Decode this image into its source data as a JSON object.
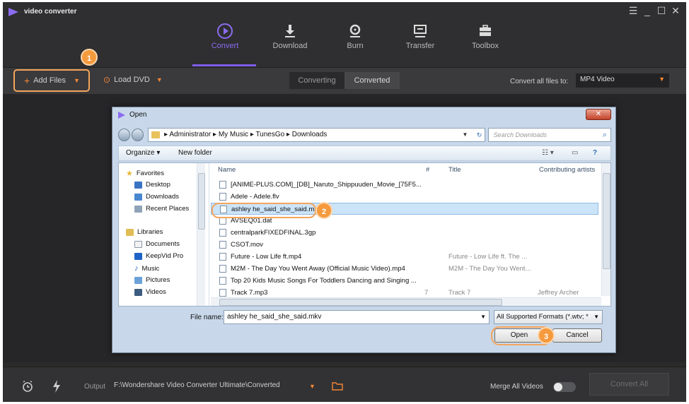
{
  "app": {
    "title": "video converter",
    "window_controls": [
      "☰",
      "_",
      "☐",
      "✕"
    ]
  },
  "nav": {
    "items": [
      {
        "label": "Convert",
        "icon": "convert-icon",
        "active": true
      },
      {
        "label": "Download",
        "icon": "download-icon"
      },
      {
        "label": "Burn",
        "icon": "burn-icon"
      },
      {
        "label": "Transfer",
        "icon": "transfer-icon"
      },
      {
        "label": "Toolbox",
        "icon": "toolbox-icon"
      }
    ]
  },
  "toolbar": {
    "add_files": "Add Files",
    "load_dvd": "Load DVD",
    "tab_converting": "Converting",
    "tab_converted": "Converted",
    "convert_all_label": "Convert all files to:",
    "format": "MP4 Video"
  },
  "badges": {
    "one": "1",
    "two": "2",
    "three": "3"
  },
  "bottom": {
    "output_label": "Output",
    "output_path": "F:\\Wondershare Video Converter Ultimate\\Converted",
    "merge_label": "Merge All Videos",
    "convert_all": "Convert All"
  },
  "dialog": {
    "title": "Open",
    "breadcrumb": [
      "Administrator",
      "My Music",
      "TunesGo",
      "Downloads"
    ],
    "breadcrumb_text": "▸ Administrator ▸ My Music ▸ TunesGo ▸ Downloads",
    "search_placeholder": "Search Downloads",
    "organize": "Organize ▾",
    "new_folder": "New folder",
    "nav_pane": {
      "favorites": "Favorites",
      "desktop": "Desktop",
      "downloads": "Downloads",
      "recent": "Recent Places",
      "libraries": "Libraries",
      "documents": "Documents",
      "keepvid": "KeepVid Pro",
      "music": "Music",
      "pictures": "Pictures",
      "videos": "Videos"
    },
    "columns": {
      "name": "Name",
      "num": "#",
      "title": "Title",
      "artists": "Contributing artists"
    },
    "files": [
      {
        "name": "[ANIME-PLUS.COM]_[DB]_Naruto_Shippuuden_Movie_[75F5...",
        "num": "",
        "title": "",
        "artist": ""
      },
      {
        "name": "Adele - Adele.flv",
        "num": "",
        "title": "",
        "artist": ""
      },
      {
        "name": "ashley he_said_she_said.mkv",
        "num": "",
        "title": "",
        "artist": ""
      },
      {
        "name": "AVSEQ01.dat",
        "num": "",
        "title": "",
        "artist": ""
      },
      {
        "name": "centralparkFIXEDFINAL.3gp",
        "num": "",
        "title": "",
        "artist": ""
      },
      {
        "name": "CSOT.mov",
        "num": "",
        "title": "",
        "artist": ""
      },
      {
        "name": "Future - Low Life ft.mp4",
        "num": "",
        "title": "Future - Low Life ft. The ...",
        "artist": ""
      },
      {
        "name": "M2M - The Day You Went Away (Official Music Video).mp4",
        "num": "",
        "title": "M2M - The Day You Went...",
        "artist": ""
      },
      {
        "name": "Top 20 Kids Music Songs For Toddlers Dancing and Singing ...",
        "num": "",
        "title": "",
        "artist": ""
      },
      {
        "name": "Track 7.mp3",
        "num": "7",
        "title": "Track 7",
        "artist": "Jeffrey Archer"
      }
    ],
    "file_name_label": "File name:",
    "file_name_value": "ashley he_said_she_said.mkv",
    "filter": "All Supported Formats (*.wtv; *",
    "open": "Open",
    "cancel": "Cancel"
  },
  "colors": {
    "accent": "#7d5ce8",
    "orange": "#f58634"
  }
}
